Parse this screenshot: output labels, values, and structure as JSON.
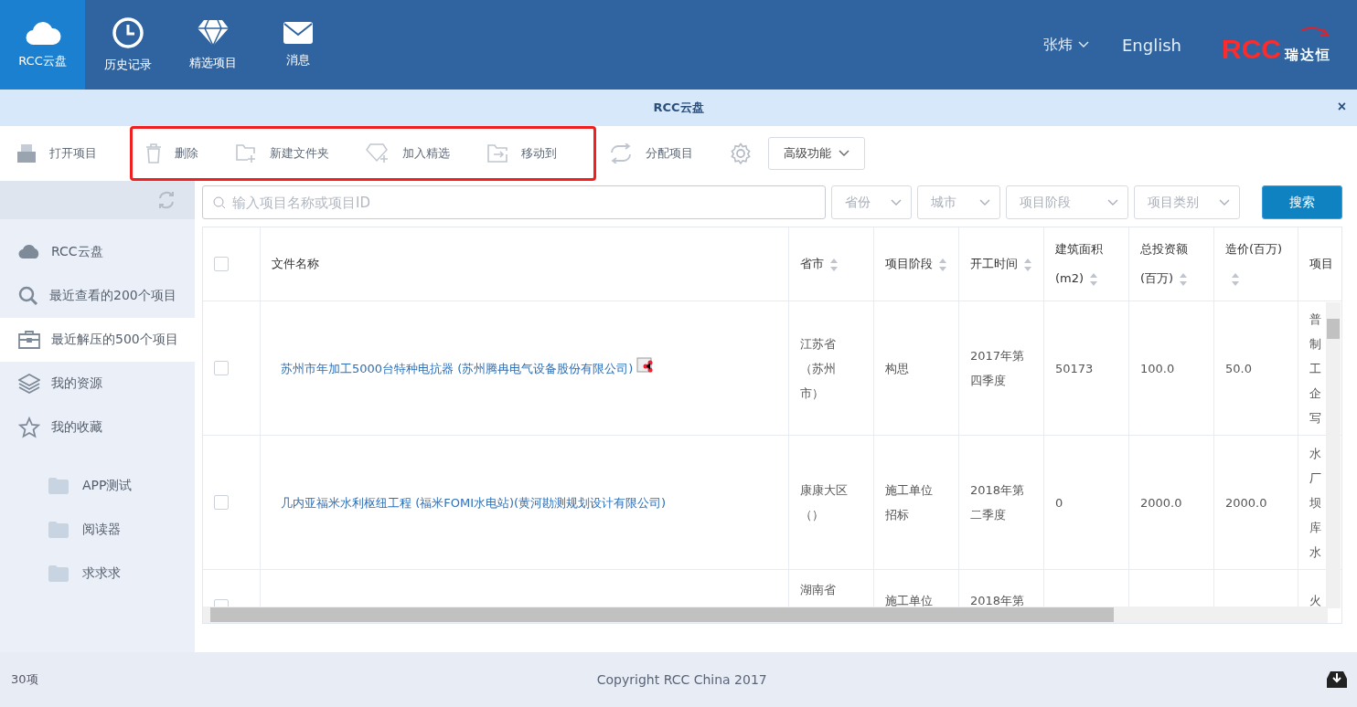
{
  "nav": {
    "tabs": [
      {
        "label": "RCC云盘",
        "selected": true
      },
      {
        "label": "历史记录",
        "selected": false
      },
      {
        "label": "精选项目",
        "selected": false
      },
      {
        "label": "消息",
        "selected": false
      }
    ],
    "user": "张炜",
    "language": "English",
    "logo": {
      "mark": "RCC",
      "name": "瑞达恒"
    }
  },
  "panel": {
    "title": "RCC云盘",
    "close": "×"
  },
  "toolbar": {
    "leading": [
      "打开项目"
    ],
    "highlighted": [
      "删除",
      "新建文件夹",
      "加入精选",
      "移动到"
    ],
    "trailing": [
      "分配项目"
    ],
    "advanced": "高级功能"
  },
  "sidebar": {
    "items": [
      {
        "label": "RCC云盘",
        "selected": false
      },
      {
        "label": "最近查看的200个项目",
        "selected": false
      },
      {
        "label": "最近解压的500个项目",
        "selected": true
      },
      {
        "label": "我的资源",
        "selected": false
      },
      {
        "label": "我的收藏",
        "selected": false
      }
    ],
    "folders": [
      "APP测试",
      "阅读器",
      "求求求"
    ]
  },
  "search": {
    "placeholder": "输入项目名称或项目ID",
    "filters": [
      "省份",
      "城市",
      "项目阶段",
      "项目类别"
    ],
    "button": "搜索"
  },
  "table": {
    "header_checked": false,
    "columns": [
      {
        "label": "文件名称",
        "sortable": false
      },
      {
        "label": "省市",
        "sortable": true
      },
      {
        "label": "项目阶段",
        "sortable": true
      },
      {
        "label": "开工时间",
        "sortable": true
      },
      {
        "label": "建筑面积(m2)",
        "sortable": true
      },
      {
        "label": "总投资额(百万)",
        "sortable": true
      },
      {
        "label": "造价(百万)",
        "sortable": true
      },
      {
        "label": "项目",
        "sortable": false
      }
    ],
    "rows": [
      {
        "checked": false,
        "shared": true,
        "cells": [
          "苏州市年加工5000台特种电抗器 (苏州腾冉电气设备股份有限公司)",
          "江苏省（苏州市）",
          "构思",
          "2017年第四季度",
          "50173",
          "100.0",
          "50.0",
          "普制工企写"
        ]
      },
      {
        "checked": false,
        "shared": false,
        "cells": [
          "几内亚福米水利枢纽工程 (福米FOMI水电站)(黄河勘测规划设计有限公司)",
          "康康大区（）",
          "施工单位招标",
          "2018年第二季度",
          "0",
          "2000.0",
          "2000.0",
          "水厂坝库水"
        ]
      },
      {
        "checked": false,
        "cells": [
          "",
          "湖南省",
          "施工单位",
          "2018年第",
          "",
          "",
          "",
          "火"
        ]
      }
    ]
  },
  "footer": {
    "count": "30项",
    "copyright": "Copyright RCC China 2017"
  }
}
